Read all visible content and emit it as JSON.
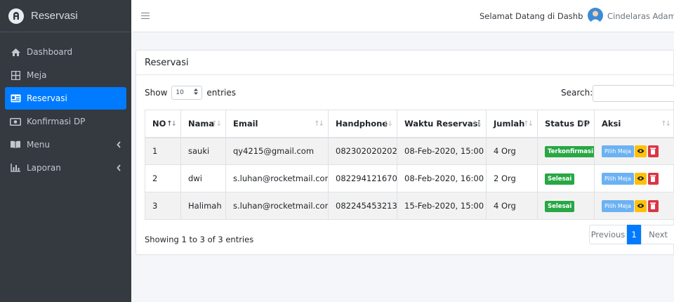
{
  "brand": {
    "name": "Reservasi"
  },
  "sidebar": {
    "items": [
      {
        "label": "Dashboard",
        "icon": "home-icon"
      },
      {
        "label": "Meja",
        "icon": "grid-icon"
      },
      {
        "label": "Reservasi",
        "icon": "id-card-icon",
        "active": true
      },
      {
        "label": "Konfirmasi DP",
        "icon": "money-bill-icon"
      },
      {
        "label": "Menu",
        "icon": "book-icon",
        "expandable": true
      },
      {
        "label": "Laporan",
        "icon": "chart-icon",
        "expandable": true
      }
    ]
  },
  "topbar": {
    "welcome": "Selamat Datang di Dashboa",
    "user_name": "Cindelaras Adam Mali"
  },
  "card": {
    "title": "Reservasi",
    "length": {
      "prefix": "Show",
      "value": "10",
      "suffix": "entries"
    },
    "search_label": "Search:",
    "search_value": ""
  },
  "table": {
    "headers": [
      "NO",
      "Nama",
      "Email",
      "Handphone",
      "Waktu Reservasi",
      "Jumlah",
      "Status DP",
      "Aksi"
    ],
    "rows": [
      {
        "no": "1",
        "nama": "sauki",
        "email": "qy4215@gmail.com",
        "hp": "082302020202",
        "waktu": "08-Feb-2020, 15:00",
        "jumlah": "4 Org",
        "status": "Terkonfirmasi"
      },
      {
        "no": "2",
        "nama": "dwi",
        "email": "s.luhan@rocketmail.com",
        "hp": "082294121670",
        "waktu": "08-Feb-2020, 16:00",
        "jumlah": "2 Org",
        "status": "Selesai"
      },
      {
        "no": "3",
        "nama": "Halimah",
        "email": "s.luhan@rocketmail.com",
        "hp": "082245453213",
        "waktu": "15-Feb-2020, 15:00",
        "jumlah": "4 Org",
        "status": "Selesai"
      }
    ],
    "action_label": "Pilih Meja"
  },
  "footer": {
    "info": "Showing 1 to 3 of 3 entries",
    "pager": {
      "prev": "Previous",
      "current": "1",
      "next": "Next"
    }
  },
  "colors": {
    "sidebar": "#343a40",
    "active": "#007bff",
    "badge": "#28a745",
    "warn": "#ffc107",
    "danger": "#dc3545"
  }
}
